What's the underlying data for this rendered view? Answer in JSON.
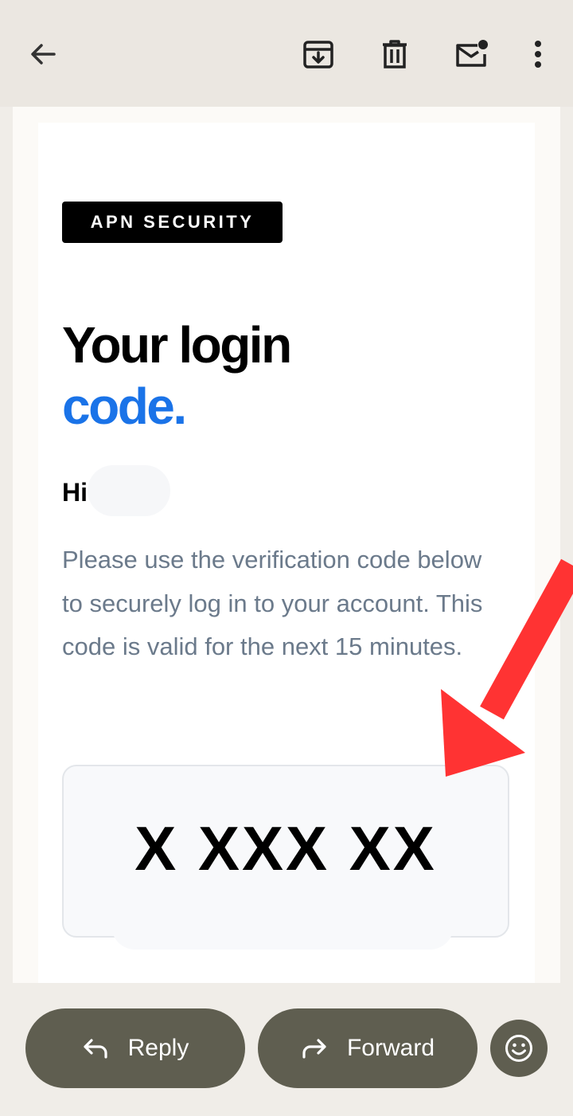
{
  "toolbar": {
    "back": "back-arrow-icon",
    "archive": "archive-icon",
    "delete": "trash-icon",
    "mark_unread": "mail-unread-icon",
    "more": "more-vert-icon"
  },
  "email": {
    "badge": "APN SECURITY",
    "title_line1": "Your login",
    "title_line2": "code.",
    "greeting": "Hi",
    "body": "Please use the verification code below to securely log in to your account. This code is valid for the next 15 minutes.",
    "code": "X XXX XX"
  },
  "actions": {
    "reply_label": "Reply",
    "forward_label": "Forward",
    "emoji": "emoji-react-icon"
  },
  "colors": {
    "accent": "#1a73e8",
    "body_text": "#6b7a8b",
    "annotation_arrow": "#ff3333",
    "action_pill": "#5f5e50"
  }
}
